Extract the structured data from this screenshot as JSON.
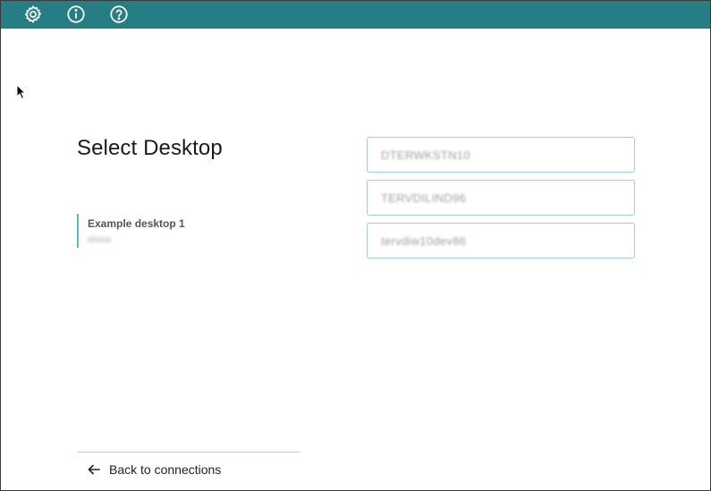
{
  "toolbar": {
    "icons": [
      "gear-icon",
      "info-icon",
      "help-icon"
    ],
    "background_color": "#267e85"
  },
  "main": {
    "title": "Select Desktop",
    "desktops": [
      {
        "name": "Example desktop 1",
        "detail": "elotze"
      }
    ],
    "hosts": [
      "DTERWKSTN10",
      "TERVDILIND96",
      "tervdiw10dev86"
    ]
  },
  "footer": {
    "back_label": "Back to connections",
    "back_icon": "arrow-left-icon"
  },
  "colors": {
    "accent": "#5fb7c0",
    "field_border": "#9fcdd3"
  }
}
